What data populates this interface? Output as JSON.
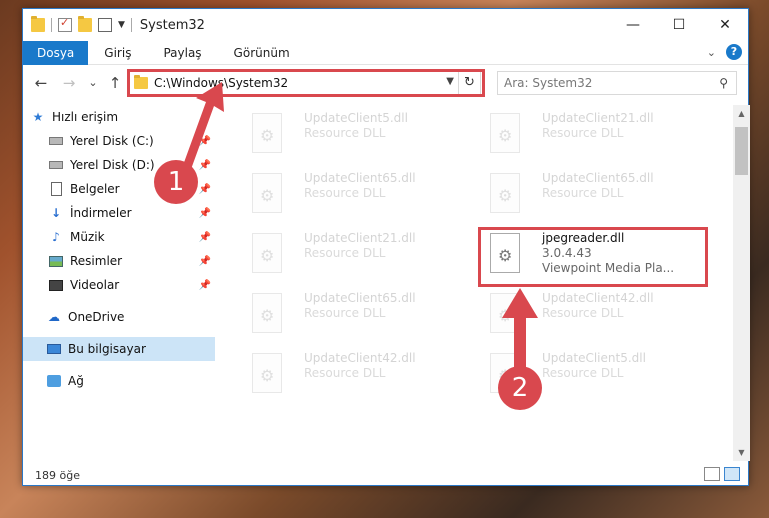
{
  "window": {
    "title": "System32",
    "controls": {
      "minimize": "—",
      "maximize": "☐",
      "close": "✕"
    }
  },
  "ribbon": {
    "tabs": [
      {
        "label": "Dosya",
        "active": true
      },
      {
        "label": "Giriş"
      },
      {
        "label": "Paylaş"
      },
      {
        "label": "Görünüm"
      }
    ],
    "help": "?"
  },
  "address": {
    "back": "←",
    "forward": "→",
    "recent": "⌄",
    "up": "↑",
    "path": "C:\\Windows\\System32",
    "refresh": "↻"
  },
  "search": {
    "placeholder": "Ara: System32",
    "icon": "⚲"
  },
  "nav": {
    "items": [
      {
        "label": "Hızlı erişim"
      },
      {
        "label": "Yerel Disk (C:)"
      },
      {
        "label": "Yerel Disk (D:)"
      },
      {
        "label": "Belgeler"
      },
      {
        "label": "İndirmeler"
      },
      {
        "label": "Müzik"
      },
      {
        "label": "Resimler"
      },
      {
        "label": "Videolar"
      },
      {
        "label": "OneDrive"
      },
      {
        "label": "Bu bilgisayar"
      },
      {
        "label": "Ağ"
      }
    ]
  },
  "files": [
    {
      "name": "UpdateClient5.dll",
      "type": "Resource DLL"
    },
    {
      "name": "UpdateClient21.dll",
      "type": "Resource DLL"
    },
    {
      "name": "UpdateClient65.dll",
      "type": "Resource DLL"
    },
    {
      "name": "UpdateClient65.dll",
      "type": "Resource DLL"
    },
    {
      "name": "UpdateClient21.dll",
      "type": "Resource DLL"
    },
    {
      "name": "jpegreader.dll",
      "type": "3.0.4.43",
      "desc": "Viewpoint Media Pla..."
    },
    {
      "name": "UpdateClient65.dll",
      "type": "Resource DLL"
    },
    {
      "name": "UpdateClient42.dll",
      "type": "Resource DLL"
    },
    {
      "name": "UpdateClient42.dll",
      "type": "Resource DLL"
    },
    {
      "name": "UpdateClient5.dll",
      "type": "Resource DLL"
    }
  ],
  "status": {
    "count": "189 öğe"
  },
  "annotations": {
    "step1": "1",
    "step2": "2",
    "color": "#d9484e"
  }
}
